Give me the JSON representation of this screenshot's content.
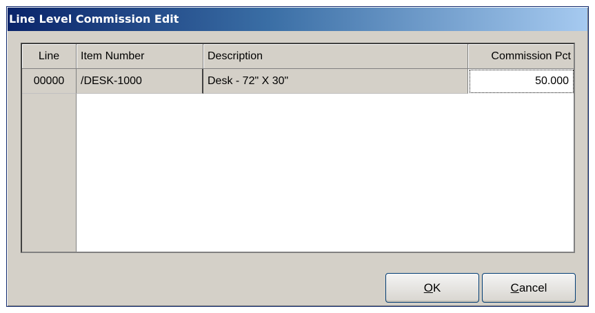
{
  "window": {
    "title": "Line Level Commission Edit"
  },
  "grid": {
    "columns": [
      {
        "label": "Line"
      },
      {
        "label": "Item Number"
      },
      {
        "label": "Description"
      },
      {
        "label": "Commission Pct"
      }
    ],
    "rows": [
      {
        "line": "00000",
        "item_number": "/DESK-1000",
        "description": "Desk - 72\" X 30\"",
        "commission_pct": "50.000"
      }
    ]
  },
  "buttons": {
    "ok": {
      "mnemonic": "O",
      "rest": "K"
    },
    "cancel": {
      "mnemonic": "C",
      "rest": "ancel"
    }
  }
}
